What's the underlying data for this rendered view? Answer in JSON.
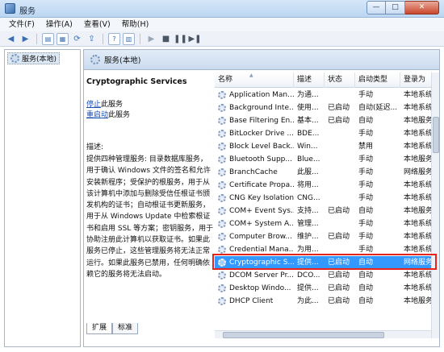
{
  "window": {
    "title": "服务",
    "minimize": "—",
    "maximize": "□",
    "close": "✕"
  },
  "menu": [
    "文件(F)",
    "操作(A)",
    "查看(V)",
    "帮助(H)"
  ],
  "toolbar": {
    "icons": [
      "back-arrow-icon",
      "forward-arrow-icon",
      "console-tree-icon",
      "properties-icon",
      "refresh-icon",
      "export-icon",
      "help-icon",
      "panel-icon",
      "start-icon",
      "stop-icon",
      "pause-icon",
      "restart-icon"
    ]
  },
  "tree": {
    "root": "服务(本地)"
  },
  "pane": {
    "header": "服务(本地)"
  },
  "description": {
    "title": "Cryptographic Services",
    "stop_link": "停止",
    "stop_suffix": "此服务",
    "restart_link": "重启动",
    "restart_suffix": "此服务",
    "label": "描述:",
    "text": "提供四种管理服务: 目录数据库服务，用于确认 Windows 文件的签名和允许安装新程序；受保护的根服务，用于从该计算机中添加与删除受信任根证书颁发机构的证书；自动根证书更新服务，用于从 Windows Update 中检索根证书和启用 SSL 等方案；密钥服务，用于协助注册此计算机以获取证书。如果此服务已停止，这些管理服务将无法正常运行。如果此服务已禁用，任何明确依赖它的服务将无法启动。"
  },
  "table": {
    "columns": [
      "名称",
      "描述",
      "状态",
      "启动类型",
      "登录为"
    ],
    "rows": [
      {
        "name": "Application Man...",
        "desc": "为通...",
        "status": "",
        "startup": "手动",
        "logon": "本地系统"
      },
      {
        "name": "Background Inte...",
        "desc": "使用...",
        "status": "已启动",
        "startup": "自动(延迟...",
        "logon": "本地系统"
      },
      {
        "name": "Base Filtering En...",
        "desc": "基本...",
        "status": "已启动",
        "startup": "自动",
        "logon": "本地服务"
      },
      {
        "name": "BitLocker Drive ...",
        "desc": "BDE...",
        "status": "",
        "startup": "手动",
        "logon": "本地系统"
      },
      {
        "name": "Block Level Back...",
        "desc": "Win...",
        "status": "",
        "startup": "禁用",
        "logon": "本地系统"
      },
      {
        "name": "Bluetooth Supp...",
        "desc": "Blue...",
        "status": "",
        "startup": "手动",
        "logon": "本地服务"
      },
      {
        "name": "BranchCache",
        "desc": "此服...",
        "status": "",
        "startup": "手动",
        "logon": "网络服务"
      },
      {
        "name": "Certificate Propa...",
        "desc": "将用...",
        "status": "",
        "startup": "手动",
        "logon": "本地系统"
      },
      {
        "name": "CNG Key Isolation",
        "desc": "CNG...",
        "status": "",
        "startup": "手动",
        "logon": "本地系统"
      },
      {
        "name": "COM+ Event Sys...",
        "desc": "支持...",
        "status": "已启动",
        "startup": "自动",
        "logon": "本地服务"
      },
      {
        "name": "COM+ System A...",
        "desc": "管理...",
        "status": "",
        "startup": "手动",
        "logon": "本地系统"
      },
      {
        "name": "Computer Brow...",
        "desc": "维护...",
        "status": "已启动",
        "startup": "手动",
        "logon": "本地系统"
      },
      {
        "name": "Credential Mana...",
        "desc": "为用...",
        "status": "",
        "startup": "手动",
        "logon": "本地系统"
      },
      {
        "name": "Cryptographic S...",
        "desc": "提供...",
        "status": "已启动",
        "startup": "自动",
        "logon": "网络服务"
      },
      {
        "name": "DCOM Server Pr...",
        "desc": "DCO...",
        "status": "已启动",
        "startup": "自动",
        "logon": "本地系统"
      },
      {
        "name": "Desktop Windo...",
        "desc": "提供...",
        "status": "已启动",
        "startup": "自动",
        "logon": "本地系统"
      },
      {
        "name": "DHCP Client",
        "desc": "为此...",
        "status": "已启动",
        "startup": "自动",
        "logon": "本地服务"
      }
    ],
    "selected_index": 13
  },
  "tabs": [
    "扩展",
    "标准"
  ]
}
